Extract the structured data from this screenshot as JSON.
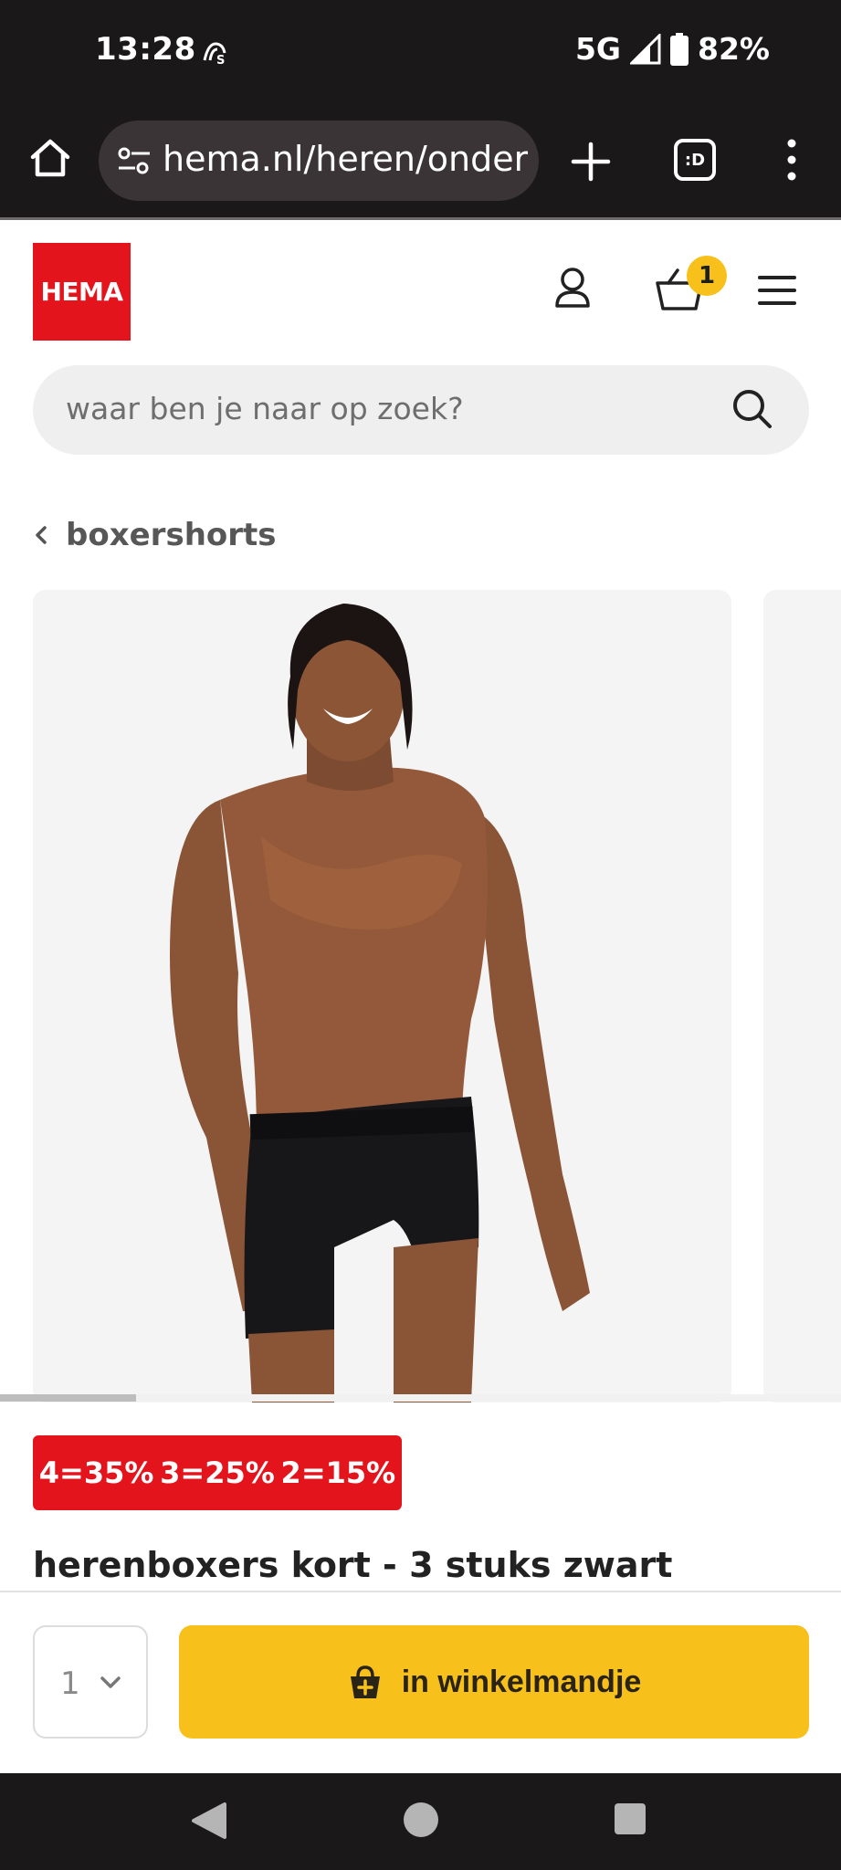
{
  "status_bar": {
    "time": "13:28",
    "network": "5G",
    "battery": "82%"
  },
  "browser": {
    "url": "hema.nl/heren/onderg",
    "tabs_count": ":D"
  },
  "header": {
    "logo_text": "HEMA",
    "cart_count": "1",
    "brand_color": "#e3141c"
  },
  "search": {
    "placeholder": "waar ben je naar op zoek?"
  },
  "breadcrumb": {
    "label": "boxershorts"
  },
  "promo": {
    "items": [
      "4=35%",
      "3=25%",
      "2=15%"
    ],
    "color": "#e3141c"
  },
  "product": {
    "title": "herenboxers kort - 3 stuks zwart"
  },
  "buy_bar": {
    "quantity": "1",
    "add_to_cart_label": "in winkelmandje",
    "accent": "#f8c01b"
  }
}
